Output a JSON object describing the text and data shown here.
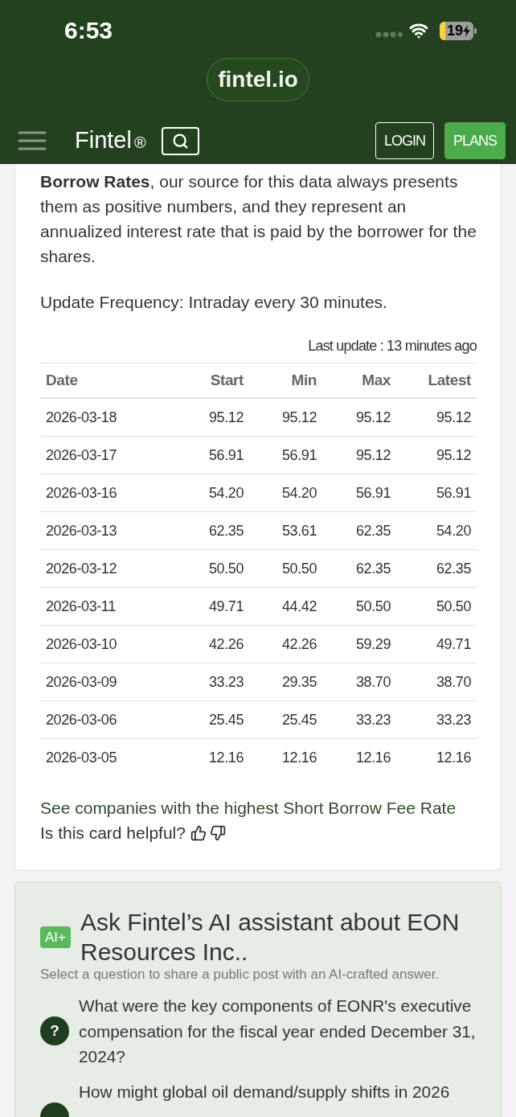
{
  "status_bar": {
    "time": "6:53",
    "battery": "19"
  },
  "address_bar": {
    "url": "fintel.io"
  },
  "nav": {
    "brand": "Fintel",
    "brand_mark": "®",
    "buttons": [
      {
        "label": "LOGIN",
        "kind": "outline"
      },
      {
        "label": "PLANS",
        "kind": "filled"
      }
    ]
  },
  "borrow_card": {
    "paragraphs": [
      "**Borrow Rates**, our source for this data always presents them as positive numbers, and they represent an annualized interest rate that is paid by the borrower for the shares.",
      "Update Frequency: Intraday every 30 minutes."
    ],
    "last_update": "Last update : 13 minutes ago",
    "table": {
      "columns": [
        "Date",
        "Start",
        "Min",
        "Max",
        "Latest"
      ],
      "rows": [
        [
          "2026-03-18",
          "95.12",
          "95.12",
          "95.12",
          "95.12"
        ],
        [
          "2026-03-17",
          "56.91",
          "56.91",
          "95.12",
          "95.12"
        ],
        [
          "2026-03-16",
          "54.20",
          "54.20",
          "56.91",
          "56.91"
        ],
        [
          "2026-03-13",
          "62.35",
          "53.61",
          "62.35",
          "54.20"
        ],
        [
          "2026-03-12",
          "50.50",
          "50.50",
          "62.35",
          "62.35"
        ],
        [
          "2026-03-11",
          "49.71",
          "44.42",
          "50.50",
          "50.50"
        ],
        [
          "2026-03-10",
          "42.26",
          "42.26",
          "59.29",
          "49.71"
        ],
        [
          "2026-03-09",
          "33.23",
          "29.35",
          "38.70",
          "38.70"
        ],
        [
          "2026-03-06",
          "25.45",
          "25.45",
          "33.23",
          "33.23"
        ],
        [
          "2026-03-05",
          "12.16",
          "12.16",
          "12.16",
          "12.16"
        ]
      ]
    },
    "link": "See companies with the highest Short Borrow Fee Rate",
    "feedback": "Is this card helpful?"
  },
  "ai_card": {
    "badge": "AI+",
    "title": "Ask Fintel’s AI assistant about EON Resources Inc..",
    "subtitle": "Select a question to share a public post with an AI-crafted answer.",
    "questions": [
      {
        "icon": "?",
        "text": "What were the key components of EONR's executive compensation for the fiscal year ended December 31, 2024?"
      },
      {
        "text": "How might global oil demand/supply shifts in 2026"
      }
    ]
  }
}
